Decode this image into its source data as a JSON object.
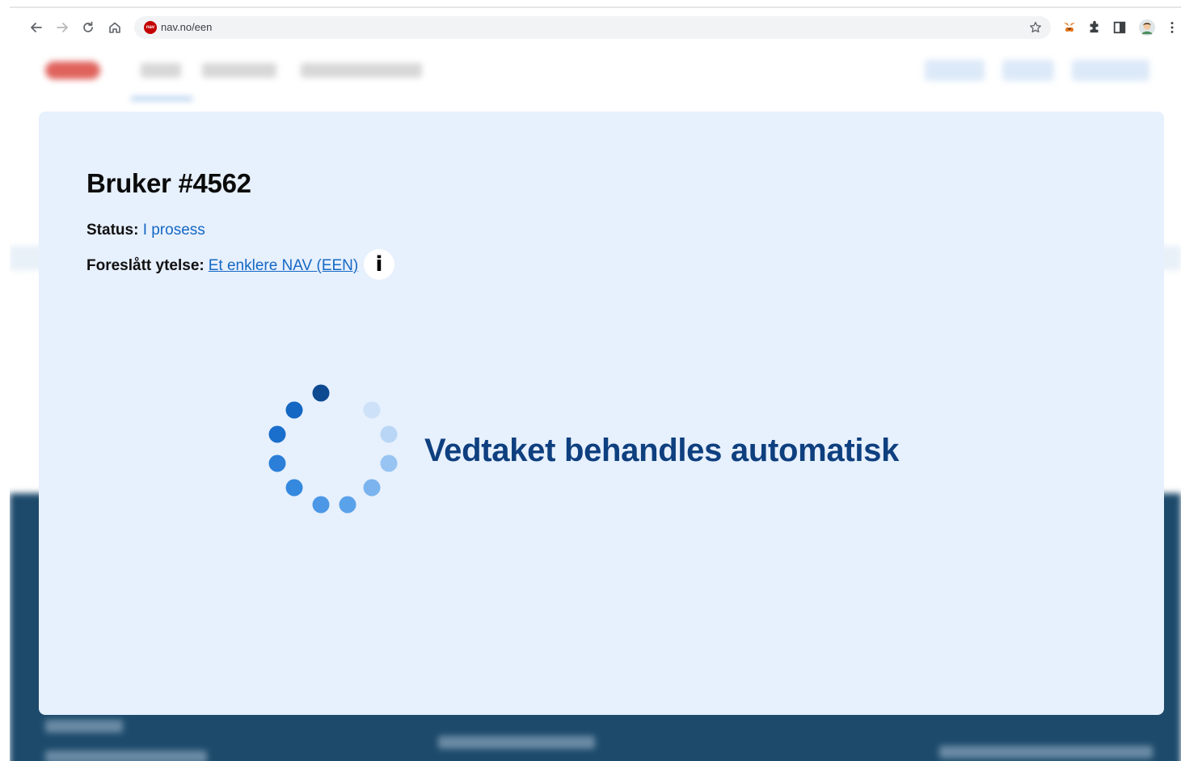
{
  "browser": {
    "url": "nav.no/een",
    "favicon_text": "nav"
  },
  "card": {
    "user_title": "Bruker #4562",
    "status_label": "Status:",
    "status_value": "I prosess",
    "ytelse_label": "Foreslått ytelse:",
    "ytelse_link": "Et enklere NAV (EEN)",
    "info_symbol": "i",
    "processing_text": "Vedtaket behandles automatisk"
  },
  "icons": [
    "back-icon",
    "forward-icon",
    "reload-icon",
    "home-icon",
    "star-icon",
    "metamask-icon",
    "puzzle-icon",
    "sidepanel-icon",
    "profile-avatar",
    "kebab-menu-icon",
    "info-icon",
    "loading-spinner"
  ],
  "colors": {
    "card_background": "#e7f0fd",
    "link_blue": "#1568c4",
    "heading_navy": "#0e3f7f",
    "footer_navy": "#1d4a6b"
  }
}
